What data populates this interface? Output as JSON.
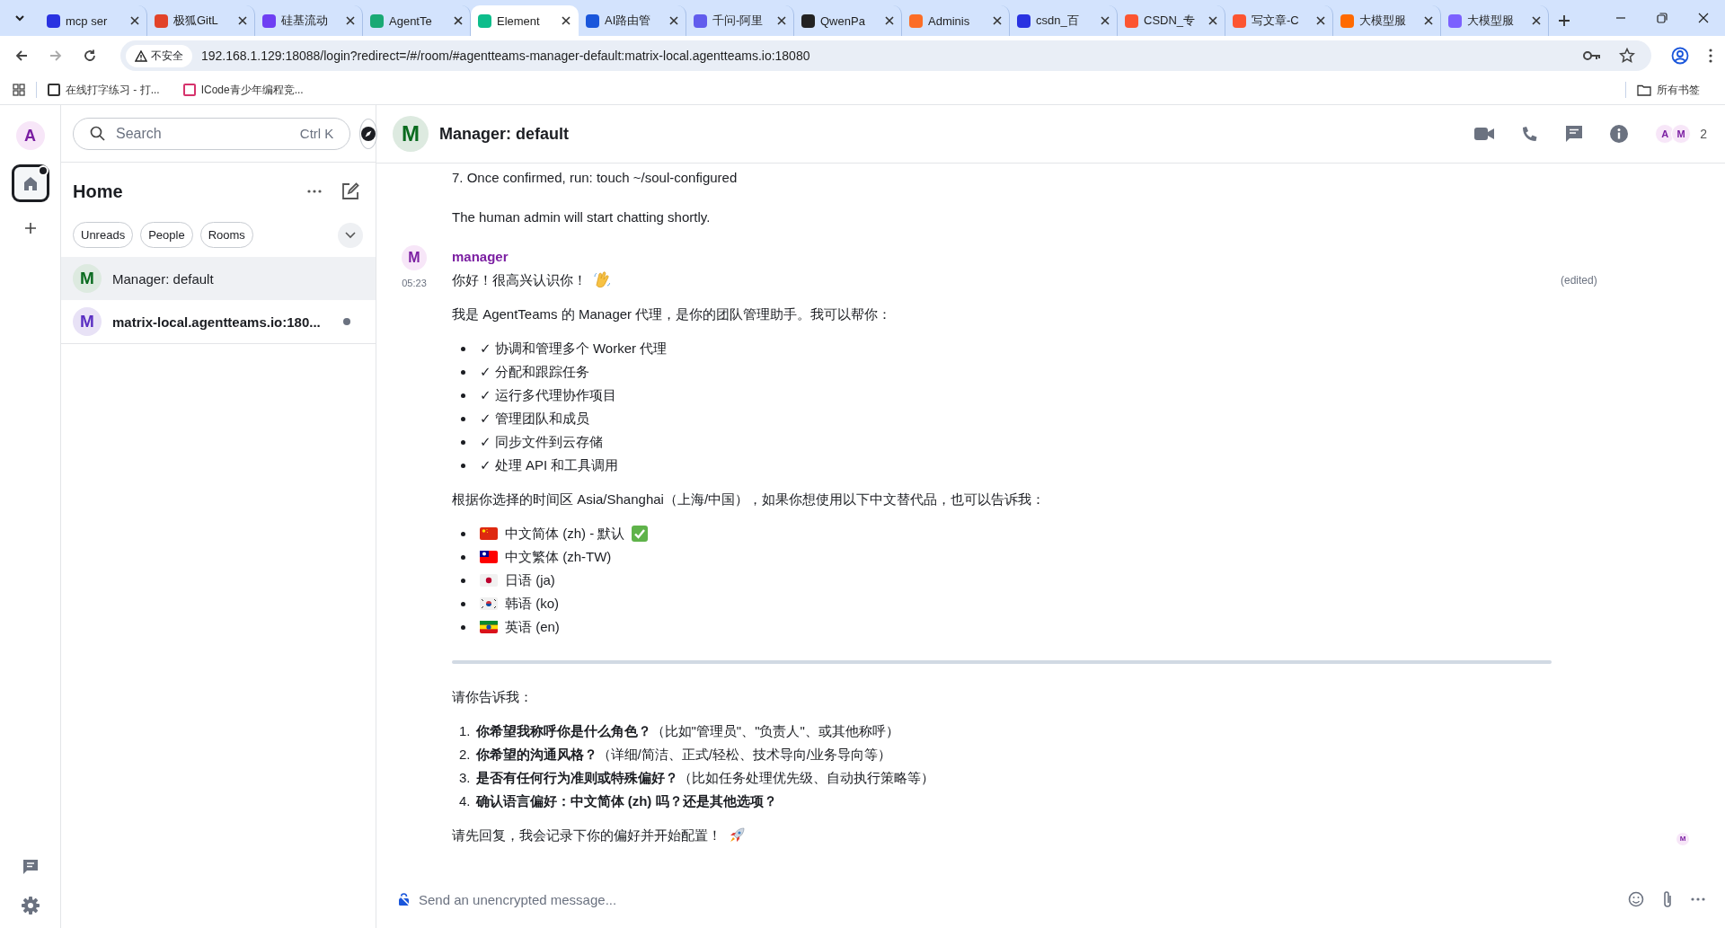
{
  "browser": {
    "tabs": [
      {
        "label": "mcp ser",
        "selected": false,
        "color": "#2932e1"
      },
      {
        "label": "极狐GitL",
        "selected": false,
        "color": "#e24329"
      },
      {
        "label": "硅基流动",
        "selected": false,
        "color": "#6e3ff3"
      },
      {
        "label": "AgentTe",
        "selected": false,
        "color": "#19a974"
      },
      {
        "label": "Element",
        "selected": true,
        "color": "#0dbd8b"
      },
      {
        "label": "AI路由管",
        "selected": false,
        "color": "#1a56db"
      },
      {
        "label": "千问-阿里",
        "selected": false,
        "color": "#615ced"
      },
      {
        "label": "QwenPa",
        "selected": false,
        "color": "#222222"
      },
      {
        "label": "Adminis",
        "selected": false,
        "color": "#fc6d26"
      },
      {
        "label": "csdn_百",
        "selected": false,
        "color": "#2932e1"
      },
      {
        "label": "CSDN_专",
        "selected": false,
        "color": "#fc5531"
      },
      {
        "label": "写文章-C",
        "selected": false,
        "color": "#fc5531"
      },
      {
        "label": "大模型服",
        "selected": false,
        "color": "#ff6a00"
      },
      {
        "label": "大模型服",
        "selected": false,
        "color": "#7b61ff"
      }
    ],
    "security": "不安全",
    "url": "192.168.1.129:18088/login?redirect=/#/room/#agentteams-manager-default:matrix-local.agentteams.io:18080",
    "bookmarks": [
      {
        "label": "在线打字练习 - 打...",
        "color": "#333333"
      },
      {
        "label": "ICode青少年编程竞...",
        "color": "#d6336c"
      }
    ],
    "all_bookmarks": "所有书签"
  },
  "rail": {
    "account_initial": "A",
    "home_unread": true
  },
  "room_list": {
    "search": {
      "placeholder": "Search",
      "shortcut": "Ctrl K"
    },
    "title": "Home",
    "filters": [
      {
        "label": "Unreads",
        "selected": false
      },
      {
        "label": "People",
        "selected": false
      },
      {
        "label": "Rooms",
        "selected": false
      }
    ],
    "rooms": [
      {
        "initial": "M",
        "name": "Manager: default",
        "selected": true,
        "unread": false,
        "color": "#0a6b1f"
      },
      {
        "initial": "M",
        "name": "matrix-local.agentteams.io:180...",
        "selected": false,
        "unread": true,
        "color": "#5a2fc2"
      }
    ]
  },
  "room": {
    "initial": "M",
    "color": "#0a6b1f",
    "title": "Manager: default",
    "members": [
      {
        "initial": "A"
      },
      {
        "initial": "M"
      }
    ],
    "member_count": "2"
  },
  "timeline": {
    "continuation": [
      "7. Once confirmed, run: touch ~/soul-configured",
      "The human admin will start chatting shortly."
    ],
    "message": {
      "sender": "manager",
      "initial": "M",
      "time": "05:23",
      "edited": "(edited)",
      "blocks": [
        {
          "kind": "paragraph",
          "text": "你好！很高兴认识你！",
          "emoji": {
            "kind": "wave"
          }
        },
        {
          "kind": "paragraph",
          "text": "我是 AgentTeams 的 Manager 代理，是你的团队管理助手。我可以帮你："
        },
        {
          "kind": "bullets",
          "items": [
            {
              "text": "✓ 协调和管理多个 Worker 代理"
            },
            {
              "text": "✓ 分配和跟踪任务"
            },
            {
              "text": "✓ 运行多代理协作项目"
            },
            {
              "text": "✓ 管理团队和成员"
            },
            {
              "text": "✓ 同步文件到云存储"
            },
            {
              "text": "✓ 处理 API 和工具调用"
            }
          ]
        },
        {
          "kind": "paragraph",
          "text": "根据你选择的时间区 Asia/Shanghai（上海/中国），如果你想使用以下中文替代品，也可以告诉我："
        },
        {
          "kind": "bullets",
          "items": [
            {
              "flag": {
                "kind": "cn"
              },
              "text": "中文简体 (zh) - 默认",
              "emoji": {
                "kind": "check"
              }
            },
            {
              "flag": {
                "kind": "tw"
              },
              "text": "中文繁体 (zh-TW)"
            },
            {
              "flag": {
                "kind": "jp"
              },
              "text": "日语 (ja)"
            },
            {
              "flag": {
                "kind": "kr"
              },
              "text": "韩语 (ko)"
            },
            {
              "flag": {
                "kind": "et"
              },
              "text": "英语 (en)"
            }
          ]
        },
        {
          "kind": "rule"
        },
        {
          "kind": "paragraph",
          "text": "请你告诉我："
        },
        {
          "kind": "numbered",
          "items": [
            {
              "number": "1.",
              "text": "**你希望我称呼你是什么角色？**（比如\"管理员\"、\"负责人\"、或其他称呼）"
            },
            {
              "number": "2.",
              "text": "**你希望的沟通风格？**（详细/简洁、正式/轻松、技术导向/业务导向等）"
            },
            {
              "number": "3.",
              "text": "**是否有任何行为准则或特殊偏好？**（比如任务处理优先级、自动执行策略等）"
            },
            {
              "number": "4.",
              "text": "**确认语言偏好：中文简体 (zh) 吗？还是其他选项？**"
            }
          ]
        },
        {
          "kind": "paragraph",
          "text": "请先回复，我会记录下你的偏好并开始配置！",
          "emoji": {
            "kind": "rocket"
          }
        }
      ]
    },
    "read_receipt": "M"
  },
  "composer": {
    "placeholder": "Send an unencrypted message..."
  }
}
